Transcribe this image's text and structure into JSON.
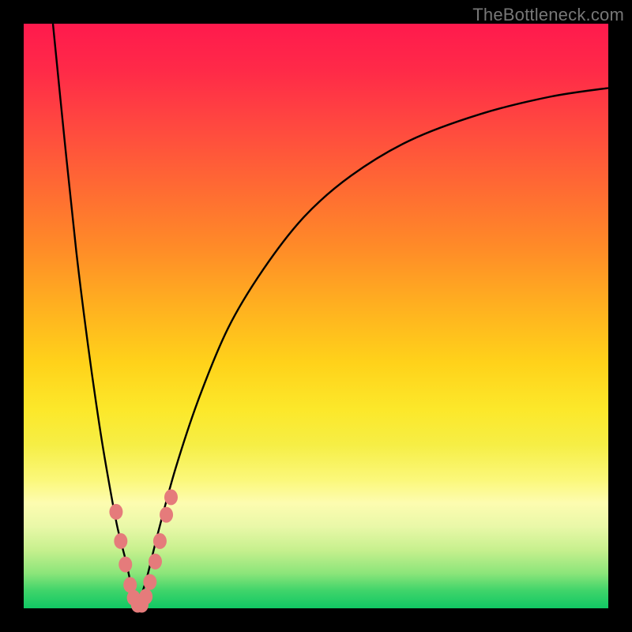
{
  "watermark": "TheBottleneck.com",
  "colors": {
    "frame": "#000000",
    "curve": "#000000",
    "marker_fill": "#e57b7b",
    "marker_stroke": "#b94c4c"
  },
  "chart_data": {
    "type": "line",
    "title": "",
    "xlabel": "",
    "ylabel": "",
    "xlim": [
      0,
      100
    ],
    "ylim": [
      0,
      100
    ],
    "grid": false,
    "legend": false,
    "notes": "V-shaped bottleneck curve on a vertical red→green gradient. Vertical position encodes bottleneck percentage (top=high, bottom=none). Pink dots mark sampled data points near the minimum.",
    "series": [
      {
        "name": "left-branch",
        "x": [
          5,
          7,
          9,
          11,
          13,
          14.5,
          16,
          17.5,
          18.5,
          19.5
        ],
        "y": [
          100,
          80,
          61,
          45,
          31,
          22,
          14,
          8,
          3.5,
          0.5
        ]
      },
      {
        "name": "right-branch",
        "x": [
          19.5,
          21,
          23,
          26,
          30,
          35,
          41,
          48,
          56,
          66,
          78,
          90,
          100
        ],
        "y": [
          0.5,
          5,
          13,
          24,
          36,
          48,
          58,
          67,
          74,
          80,
          84.5,
          87.5,
          89
        ]
      }
    ],
    "markers": [
      {
        "x": 15.8,
        "y": 16.5
      },
      {
        "x": 16.6,
        "y": 11.5
      },
      {
        "x": 17.4,
        "y": 7.5
      },
      {
        "x": 18.2,
        "y": 4.0
      },
      {
        "x": 18.8,
        "y": 1.8
      },
      {
        "x": 19.5,
        "y": 0.6
      },
      {
        "x": 20.2,
        "y": 0.6
      },
      {
        "x": 20.9,
        "y": 2.0
      },
      {
        "x": 21.6,
        "y": 4.5
      },
      {
        "x": 22.5,
        "y": 8.0
      },
      {
        "x": 23.3,
        "y": 11.5
      },
      {
        "x": 24.4,
        "y": 16.0
      },
      {
        "x": 25.2,
        "y": 19.0
      }
    ]
  }
}
